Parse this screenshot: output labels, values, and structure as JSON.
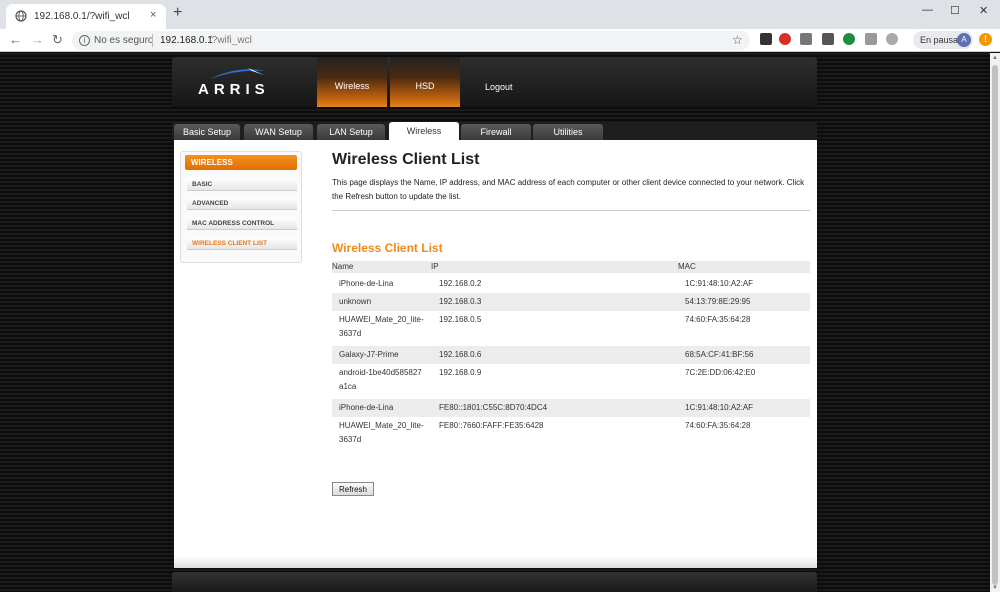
{
  "browser": {
    "tab_title": "192.168.0.1/?wifi_wcl",
    "tab_close": "×",
    "new_tab": "+",
    "win_minimize": "—",
    "win_maximize": "☐",
    "win_close": "✕",
    "nav_back": "←",
    "nav_forward": "→",
    "nav_reload": "↻",
    "security_label": "No es seguro",
    "url_host": "192.168.0.1",
    "url_path": "/?wifi_wcl",
    "star": "☆",
    "pause_label": "En pausa",
    "avatar_letter": "A",
    "update_badge": "!"
  },
  "router": {
    "logo": "ARRIS",
    "top_nav": [
      "Wireless",
      "HSD",
      "Logout"
    ],
    "tabs": [
      "Basic Setup",
      "WAN Setup",
      "LAN Setup",
      "Wireless",
      "Firewall",
      "Utilities"
    ],
    "active_tab": "Wireless"
  },
  "sidebar": {
    "header": "WIRELESS",
    "items": [
      "BASIC",
      "ADVANCED",
      "MAC ADDRESS CONTROL",
      "WIRELESS CLIENT LIST"
    ],
    "active_item": "WIRELESS CLIENT LIST"
  },
  "main": {
    "title": "Wireless Client List",
    "description": "This page displays the Name, IP address, and MAC address of each computer or other client device connected to your network. Click the Refresh button to update the list.",
    "section_title": "Wireless Client List",
    "columns": [
      "Name",
      "IP",
      "MAC"
    ],
    "rows": [
      {
        "name": "iPhone-de-Lina",
        "name2": "",
        "ip": "192.168.0.2",
        "mac": "1C:91:48:10:A2:AF"
      },
      {
        "name": "unknown",
        "name2": "",
        "ip": "192.168.0.3",
        "mac": "54:13:79:8E:29:95"
      },
      {
        "name": "HUAWEI_Mate_20_lite-",
        "name2": "3637d",
        "ip": "192.168.0.5",
        "mac": "74:60:FA:35:64:28"
      },
      {
        "name": "Galaxy-J7-Prime",
        "name2": "",
        "ip": "192.168.0.6",
        "mac": "68:5A:CF:41:BF:56"
      },
      {
        "name": "android-1be40d585827",
        "name2": "a1ca",
        "ip": "192.168.0.9",
        "mac": "7C:2E:DD:06:42:E0"
      },
      {
        "name": "iPhone-de-Lina",
        "name2": "",
        "ip": "FE80::1801:C55C:8D70:4DC4",
        "mac": "1C:91:48:10:A2:AF"
      },
      {
        "name": "HUAWEI_Mate_20_lite-",
        "name2": "3637d",
        "ip": "FE80::7660:FAFF:FE35:6428",
        "mac": "74:60:FA:35:64:28"
      }
    ],
    "refresh_label": "Refresh"
  },
  "colors": {
    "accent": "#f08a1b",
    "sidebar_header": "#e67817",
    "header_bg": "#1e1e1e"
  }
}
